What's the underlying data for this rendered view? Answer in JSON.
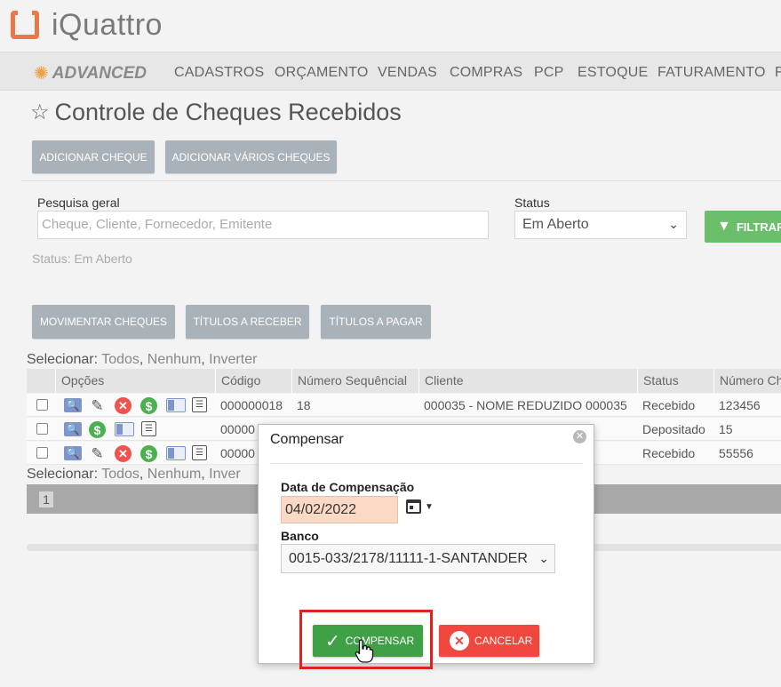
{
  "app": {
    "logo_text": "iQuattro",
    "brand": "ADVANCED"
  },
  "nav": [
    "CADASTROS",
    "ORÇAMENTO",
    "VENDAS",
    "COMPRAS",
    "PCP",
    "ESTOQUE",
    "FATURAMENTO",
    "F"
  ],
  "page": {
    "title": "Controle de Cheques Recebidos"
  },
  "actions_top": {
    "add": "ADICIONAR CHEQUE",
    "add_many": "ADICIONAR VÁRIOS CHEQUES"
  },
  "filters": {
    "search_label": "Pesquisa geral",
    "search_placeholder": "Cheque, Cliente, Fornecedor, Emitente",
    "status_label": "Status",
    "status_value": "Em Aberto",
    "filter_button": "FILTRAR",
    "status_hint": "Status: Em Aberto"
  },
  "actions_mid": {
    "move": "MOVIMENTAR CHEQUES",
    "receivable": "TÍTULOS A RECEBER",
    "payable": "TÍTULOS A PAGAR"
  },
  "selection": {
    "prefix": "Selecionar:",
    "all": "Todos",
    "none": "Nenhum",
    "invert": "Inverter",
    "invert_cut": "Inver"
  },
  "table": {
    "headers": [
      "Opções",
      "Código",
      "Número Sequêncial",
      "Cliente",
      "Status",
      "Número Ch"
    ],
    "rows": [
      {
        "code": "000000018",
        "seq": "18",
        "client": "000035 - NOME REDUZIDO 000035",
        "status": "Recebido",
        "number": "123456"
      },
      {
        "code": "00000",
        "seq": "",
        "client": "",
        "status": "Depositado",
        "number": "15"
      },
      {
        "code": "00000",
        "seq": "",
        "client": "",
        "status": "Recebido",
        "number": "55556"
      }
    ]
  },
  "pager": {
    "page": "1"
  },
  "modal": {
    "title": "Compensar",
    "date_label": "Data de Compensação",
    "date_value": "04/02/2022",
    "bank_label": "Banco",
    "bank_value": "0015-033/2178/11111-1-SANTANDER",
    "confirm": "COMPENSAR",
    "cancel": "CANCELAR"
  },
  "colors": {
    "accent_green": "#3fa045",
    "danger_red": "#f0483e",
    "highlight": "#e3211b",
    "logo_orange": "#e87a4a"
  },
  "icons": [
    "search-icon",
    "pencil-icon",
    "delete-icon",
    "dollar-icon",
    "card-icon",
    "list-icon",
    "calendar-icon",
    "check-icon",
    "close-icon",
    "hand-cursor-icon"
  ]
}
